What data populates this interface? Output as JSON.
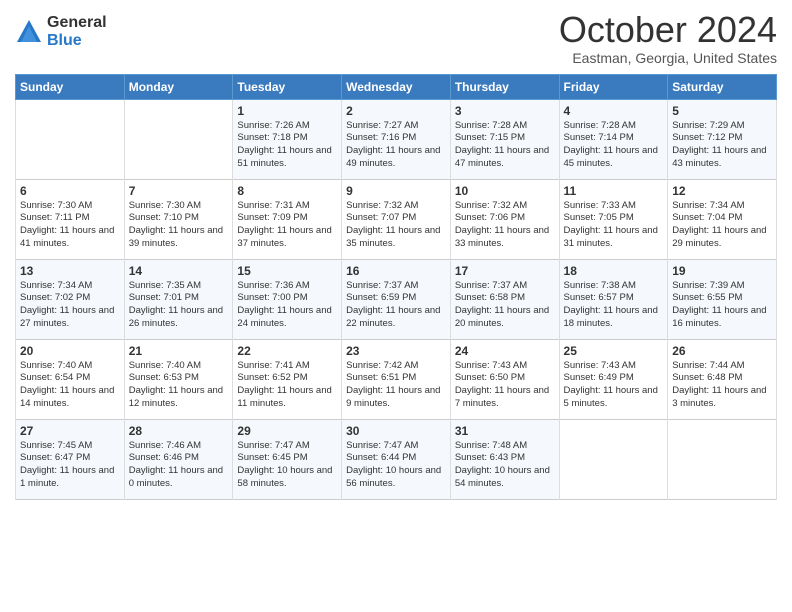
{
  "header": {
    "logo": {
      "general": "General",
      "blue": "Blue",
      "icon_color": "#2878c8"
    },
    "title": "October 2024",
    "subtitle": "Eastman, Georgia, United States"
  },
  "weekdays": [
    "Sunday",
    "Monday",
    "Tuesday",
    "Wednesday",
    "Thursday",
    "Friday",
    "Saturday"
  ],
  "weeks": [
    [
      {
        "day": "",
        "sunrise": "",
        "sunset": "",
        "daylight": ""
      },
      {
        "day": "",
        "sunrise": "",
        "sunset": "",
        "daylight": ""
      },
      {
        "day": "1",
        "sunrise": "Sunrise: 7:26 AM",
        "sunset": "Sunset: 7:18 PM",
        "daylight": "Daylight: 11 hours and 51 minutes."
      },
      {
        "day": "2",
        "sunrise": "Sunrise: 7:27 AM",
        "sunset": "Sunset: 7:16 PM",
        "daylight": "Daylight: 11 hours and 49 minutes."
      },
      {
        "day": "3",
        "sunrise": "Sunrise: 7:28 AM",
        "sunset": "Sunset: 7:15 PM",
        "daylight": "Daylight: 11 hours and 47 minutes."
      },
      {
        "day": "4",
        "sunrise": "Sunrise: 7:28 AM",
        "sunset": "Sunset: 7:14 PM",
        "daylight": "Daylight: 11 hours and 45 minutes."
      },
      {
        "day": "5",
        "sunrise": "Sunrise: 7:29 AM",
        "sunset": "Sunset: 7:12 PM",
        "daylight": "Daylight: 11 hours and 43 minutes."
      }
    ],
    [
      {
        "day": "6",
        "sunrise": "Sunrise: 7:30 AM",
        "sunset": "Sunset: 7:11 PM",
        "daylight": "Daylight: 11 hours and 41 minutes."
      },
      {
        "day": "7",
        "sunrise": "Sunrise: 7:30 AM",
        "sunset": "Sunset: 7:10 PM",
        "daylight": "Daylight: 11 hours and 39 minutes."
      },
      {
        "day": "8",
        "sunrise": "Sunrise: 7:31 AM",
        "sunset": "Sunset: 7:09 PM",
        "daylight": "Daylight: 11 hours and 37 minutes."
      },
      {
        "day": "9",
        "sunrise": "Sunrise: 7:32 AM",
        "sunset": "Sunset: 7:07 PM",
        "daylight": "Daylight: 11 hours and 35 minutes."
      },
      {
        "day": "10",
        "sunrise": "Sunrise: 7:32 AM",
        "sunset": "Sunset: 7:06 PM",
        "daylight": "Daylight: 11 hours and 33 minutes."
      },
      {
        "day": "11",
        "sunrise": "Sunrise: 7:33 AM",
        "sunset": "Sunset: 7:05 PM",
        "daylight": "Daylight: 11 hours and 31 minutes."
      },
      {
        "day": "12",
        "sunrise": "Sunrise: 7:34 AM",
        "sunset": "Sunset: 7:04 PM",
        "daylight": "Daylight: 11 hours and 29 minutes."
      }
    ],
    [
      {
        "day": "13",
        "sunrise": "Sunrise: 7:34 AM",
        "sunset": "Sunset: 7:02 PM",
        "daylight": "Daylight: 11 hours and 27 minutes."
      },
      {
        "day": "14",
        "sunrise": "Sunrise: 7:35 AM",
        "sunset": "Sunset: 7:01 PM",
        "daylight": "Daylight: 11 hours and 26 minutes."
      },
      {
        "day": "15",
        "sunrise": "Sunrise: 7:36 AM",
        "sunset": "Sunset: 7:00 PM",
        "daylight": "Daylight: 11 hours and 24 minutes."
      },
      {
        "day": "16",
        "sunrise": "Sunrise: 7:37 AM",
        "sunset": "Sunset: 6:59 PM",
        "daylight": "Daylight: 11 hours and 22 minutes."
      },
      {
        "day": "17",
        "sunrise": "Sunrise: 7:37 AM",
        "sunset": "Sunset: 6:58 PM",
        "daylight": "Daylight: 11 hours and 20 minutes."
      },
      {
        "day": "18",
        "sunrise": "Sunrise: 7:38 AM",
        "sunset": "Sunset: 6:57 PM",
        "daylight": "Daylight: 11 hours and 18 minutes."
      },
      {
        "day": "19",
        "sunrise": "Sunrise: 7:39 AM",
        "sunset": "Sunset: 6:55 PM",
        "daylight": "Daylight: 11 hours and 16 minutes."
      }
    ],
    [
      {
        "day": "20",
        "sunrise": "Sunrise: 7:40 AM",
        "sunset": "Sunset: 6:54 PM",
        "daylight": "Daylight: 11 hours and 14 minutes."
      },
      {
        "day": "21",
        "sunrise": "Sunrise: 7:40 AM",
        "sunset": "Sunset: 6:53 PM",
        "daylight": "Daylight: 11 hours and 12 minutes."
      },
      {
        "day": "22",
        "sunrise": "Sunrise: 7:41 AM",
        "sunset": "Sunset: 6:52 PM",
        "daylight": "Daylight: 11 hours and 11 minutes."
      },
      {
        "day": "23",
        "sunrise": "Sunrise: 7:42 AM",
        "sunset": "Sunset: 6:51 PM",
        "daylight": "Daylight: 11 hours and 9 minutes."
      },
      {
        "day": "24",
        "sunrise": "Sunrise: 7:43 AM",
        "sunset": "Sunset: 6:50 PM",
        "daylight": "Daylight: 11 hours and 7 minutes."
      },
      {
        "day": "25",
        "sunrise": "Sunrise: 7:43 AM",
        "sunset": "Sunset: 6:49 PM",
        "daylight": "Daylight: 11 hours and 5 minutes."
      },
      {
        "day": "26",
        "sunrise": "Sunrise: 7:44 AM",
        "sunset": "Sunset: 6:48 PM",
        "daylight": "Daylight: 11 hours and 3 minutes."
      }
    ],
    [
      {
        "day": "27",
        "sunrise": "Sunrise: 7:45 AM",
        "sunset": "Sunset: 6:47 PM",
        "daylight": "Daylight: 11 hours and 1 minute."
      },
      {
        "day": "28",
        "sunrise": "Sunrise: 7:46 AM",
        "sunset": "Sunset: 6:46 PM",
        "daylight": "Daylight: 11 hours and 0 minutes."
      },
      {
        "day": "29",
        "sunrise": "Sunrise: 7:47 AM",
        "sunset": "Sunset: 6:45 PM",
        "daylight": "Daylight: 10 hours and 58 minutes."
      },
      {
        "day": "30",
        "sunrise": "Sunrise: 7:47 AM",
        "sunset": "Sunset: 6:44 PM",
        "daylight": "Daylight: 10 hours and 56 minutes."
      },
      {
        "day": "31",
        "sunrise": "Sunrise: 7:48 AM",
        "sunset": "Sunset: 6:43 PM",
        "daylight": "Daylight: 10 hours and 54 minutes."
      },
      {
        "day": "",
        "sunrise": "",
        "sunset": "",
        "daylight": ""
      },
      {
        "day": "",
        "sunrise": "",
        "sunset": "",
        "daylight": ""
      }
    ]
  ]
}
